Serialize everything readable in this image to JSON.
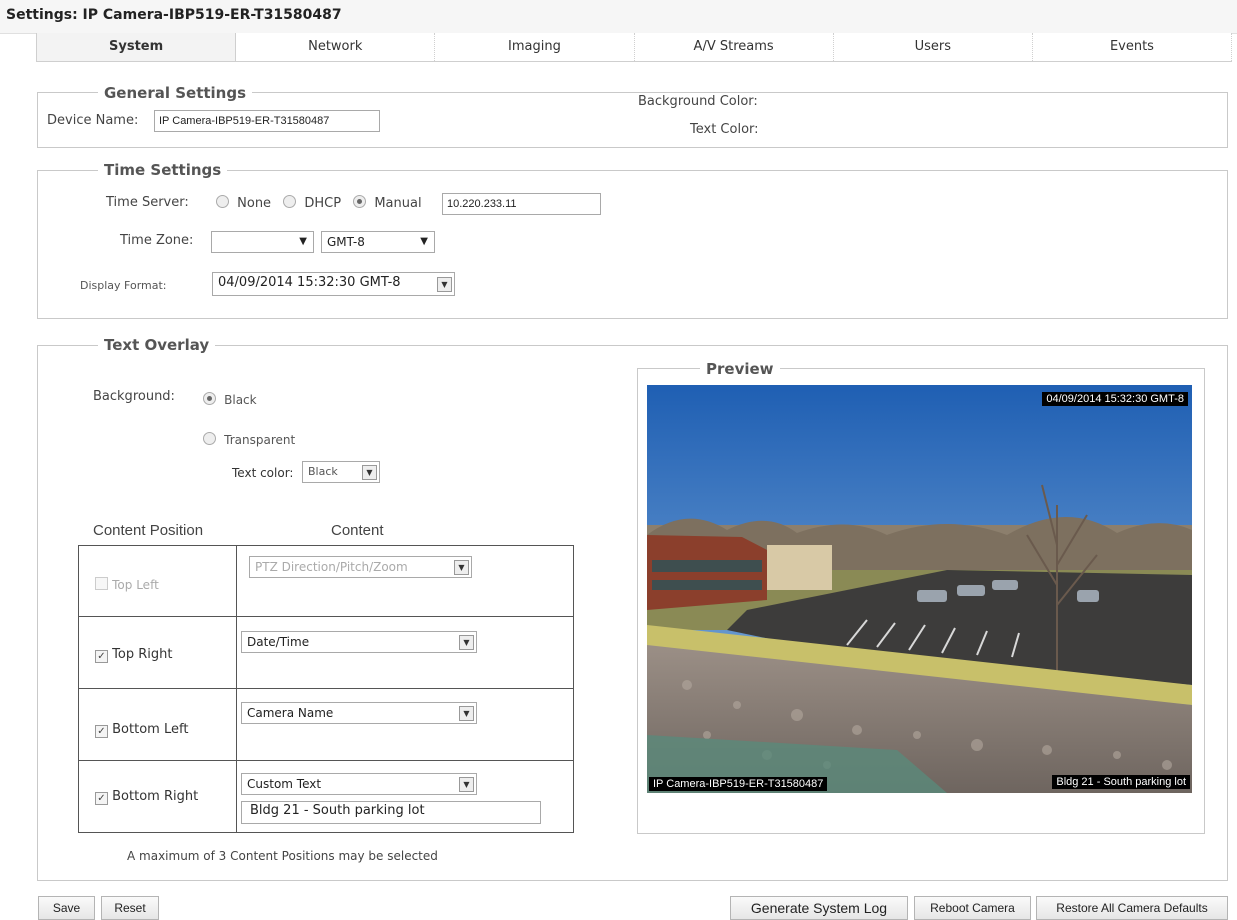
{
  "title": "Settings: IP Camera-IBP519-ER-T31580487",
  "tabs": [
    "System",
    "Network",
    "Imaging",
    "A/V Streams",
    "Users",
    "Events"
  ],
  "general": {
    "legend": "General Settings",
    "device_name_label": "Device Name:",
    "device_name_value": "IP Camera-IBP519-ER-T31580487",
    "bg_color_label": "Background Color:",
    "text_color_label": "Text Color:"
  },
  "time": {
    "legend": "Time Settings",
    "server_label": "Time Server:",
    "opt_none": "None",
    "opt_dhcp": "DHCP",
    "opt_manual": "Manual",
    "server_value": "10.220.233.11",
    "zone_label": "Time Zone:",
    "zone_value": "",
    "zone_offset": "GMT-8",
    "format_label": "Display Format:",
    "format_value": "04/09/2014 15:32:30 GMT-8"
  },
  "overlay": {
    "legend": "Text Overlay",
    "background_label": "Background:",
    "opt_black": "Black",
    "opt_transparent": "Transparent",
    "text_color_label": "Text color:",
    "text_color_value": "Black",
    "col_position": "Content Position",
    "col_content": "Content",
    "rows": [
      {
        "position": "Top Left",
        "checked": false,
        "content": "PTZ Direction/Pitch/Zoom"
      },
      {
        "position": "Top Right",
        "checked": true,
        "content": "Date/Time"
      },
      {
        "position": "Bottom Left",
        "checked": true,
        "content": "Camera Name"
      },
      {
        "position": "Bottom Right",
        "checked": true,
        "content": "Custom Text",
        "custom_text": "Bldg 21 - South parking lot"
      }
    ],
    "note": "A maximum of 3 Content Positions may be selected"
  },
  "preview": {
    "legend": "Preview",
    "top_right": "04/09/2014 15:32:30 GMT-8",
    "bottom_left": "IP Camera-IBP519-ER-T31580487",
    "bottom_right": "Bldg 21 - South parking lot"
  },
  "buttons": {
    "save": "Save",
    "reset": "Reset",
    "generate_log": "Generate System Log",
    "reboot": "Reboot Camera",
    "restore": "Restore All Camera Defaults"
  },
  "colors": {
    "accent": "#555555",
    "border": "#c9c9c9",
    "sky": "#2f74c4"
  }
}
